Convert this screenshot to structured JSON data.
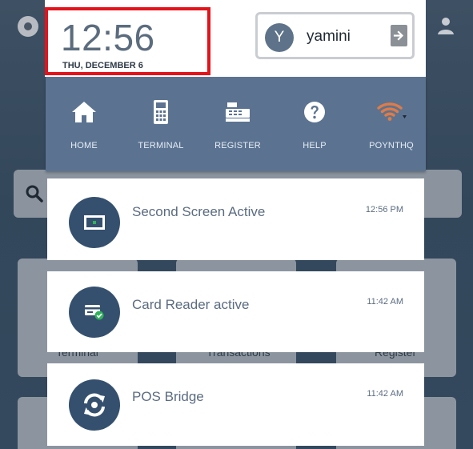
{
  "background": {
    "tiles": [
      "Terminal",
      "Transactions",
      "Register"
    ]
  },
  "clock": {
    "time": "12:56",
    "date": "THU, DECEMBER 6"
  },
  "user": {
    "initial": "Y",
    "name": "yamini"
  },
  "nav": {
    "items": [
      {
        "label": "HOME",
        "icon": "home-icon"
      },
      {
        "label": "TERMINAL",
        "icon": "terminal-icon"
      },
      {
        "label": "REGISTER",
        "icon": "register-icon"
      },
      {
        "label": "HELP",
        "icon": "help-icon"
      },
      {
        "label": "POYNTHQ",
        "icon": "wifi-icon"
      }
    ]
  },
  "notifications": [
    {
      "title": "Second Screen Active",
      "time": "12:56 PM",
      "icon": "screen-icon"
    },
    {
      "title": "Card Reader active",
      "time": "11:42 AM",
      "icon": "card-reader-icon"
    },
    {
      "title": "POS Bridge",
      "time": "11:42 AM",
      "icon": "sync-icon"
    }
  ],
  "colors": {
    "nav_bg": "#5b7391",
    "highlight_border": "#e3131b",
    "card_icon_bg": "#34506e",
    "wifi_accent": "#e07b47",
    "check_green": "#2fb35a"
  }
}
